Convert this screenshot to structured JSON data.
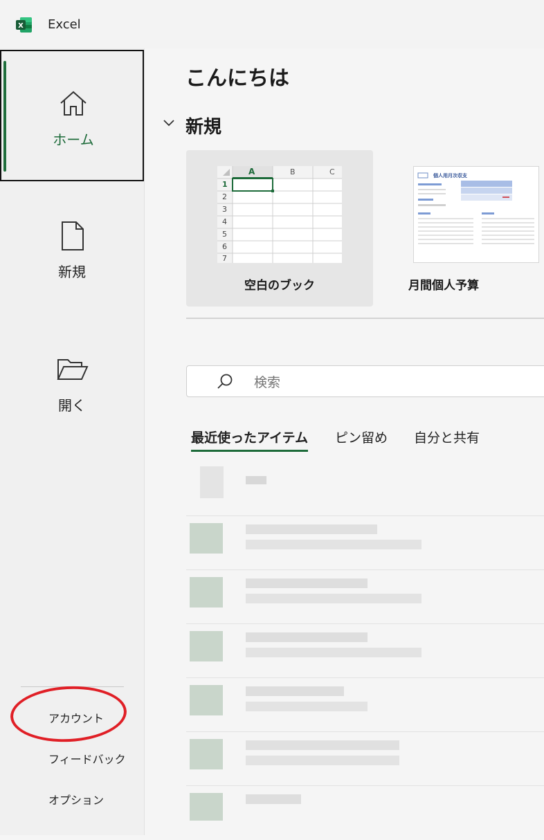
{
  "app": {
    "title": "Excel",
    "brand_color": "#1d6b3a"
  },
  "sidebar": {
    "items": [
      {
        "label": "ホーム",
        "icon": "home-icon",
        "selected": true
      },
      {
        "label": "新規",
        "icon": "new-file-icon",
        "selected": false
      },
      {
        "label": "開く",
        "icon": "open-folder-icon",
        "selected": false
      }
    ],
    "bottom": [
      {
        "label": "アカウント"
      },
      {
        "label": "フィードバック"
      },
      {
        "label": "オプション"
      }
    ]
  },
  "main": {
    "greeting": "こんにちは",
    "new_section": {
      "title": "新規"
    },
    "templates": [
      {
        "label": "空白のブック"
      },
      {
        "label": "月間個人予算"
      }
    ],
    "blank_thumb": {
      "columns": [
        "A",
        "B",
        "C"
      ],
      "rows": [
        "1",
        "2",
        "3",
        "4",
        "5",
        "6",
        "7"
      ]
    },
    "budget_thumb": {
      "heading": "個人用月次収支"
    },
    "search": {
      "placeholder": "検索"
    },
    "tabs": [
      {
        "label": "最近使ったアイテム",
        "active": true
      },
      {
        "label": "ピン留め",
        "active": false
      },
      {
        "label": "自分と共有",
        "active": false
      }
    ]
  },
  "annotation": {
    "highlight_color": "#e01f26"
  }
}
